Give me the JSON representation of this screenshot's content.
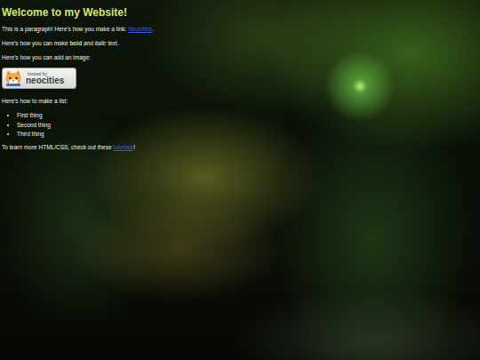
{
  "page": {
    "title": "Welcome to my Website!",
    "paragraph": {
      "before": "This is a paragraph! Here's how you make a link: ",
      "link": "Neocities",
      "after": "."
    },
    "formatting": {
      "before": "Here's how you can make ",
      "bold": "bold",
      "middle": " and ",
      "italic": "italic",
      "after": " text."
    },
    "image_intro": "Here's how you can add an image:",
    "badge": {
      "top": "hosted by",
      "bottom": "neocities"
    },
    "list_intro": "Here's how to make a list:",
    "list": [
      "First thing",
      "Second thing",
      "Third thing"
    ],
    "outro": {
      "before": "To learn more HTML/CSS, check out these ",
      "link": "tutorials",
      "after": "!"
    }
  }
}
